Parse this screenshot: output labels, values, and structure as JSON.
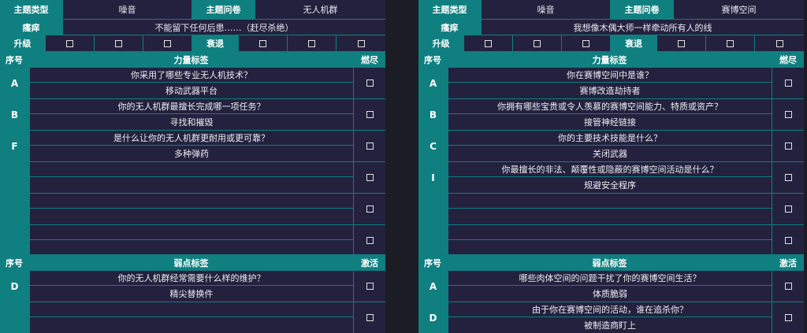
{
  "left": {
    "theme_type_label": "主题类型",
    "theme_type_value": "噪音",
    "theme_q_label": "主题问卷",
    "theme_q_value": "无人机群",
    "itch_label": "瘙痒",
    "itch_value": "不能留下任何后患……（赶尽杀绝）",
    "upgrade_label": "升级",
    "decline_label": "衰退",
    "power_header": {
      "num": "序号",
      "title": "力量标签",
      "check": "燃尽"
    },
    "power_groups": [
      {
        "letter": "A",
        "question": "你采用了哪些专业无人机技术？",
        "answer": "移动武器平台"
      },
      {
        "letter": "B",
        "question": "你的无人机群最擅长完成哪一项任务？",
        "answer": "寻找和摧毁"
      },
      {
        "letter": "F",
        "question": "是什么让你的无人机群更耐用或更可靠？",
        "answer": "多种弹药"
      },
      {
        "letter": "",
        "question": "",
        "answer": ""
      },
      {
        "letter": "",
        "question": "",
        "answer": ""
      },
      {
        "letter": "",
        "question": "",
        "answer": ""
      }
    ],
    "weak_header": {
      "num": "序号",
      "title": "弱点标签",
      "check": "激活"
    },
    "weak_groups": [
      {
        "letter": "D",
        "question": "你的无人机群经常需要什么样的维护？",
        "answer": "精尖替换件"
      },
      {
        "letter": "",
        "question": "",
        "answer": ""
      }
    ]
  },
  "right": {
    "theme_type_label": "主题类型",
    "theme_type_value": "噪音",
    "theme_q_label": "主题问卷",
    "theme_q_value": "赛博空间",
    "itch_label": "瘙痒",
    "itch_value": "我想像木偶大师一样牵动所有人的线",
    "upgrade_label": "升级",
    "decline_label": "衰退",
    "power_header": {
      "num": "序号",
      "title": "力量标签",
      "check": "燃尽"
    },
    "power_groups": [
      {
        "letter": "A",
        "question": "你在赛博空间中是谁？",
        "answer": "赛博改造劫持者"
      },
      {
        "letter": "B",
        "question": "你拥有哪些宝贵或令人羡慕的赛博空间能力、特质或资产？",
        "answer": "接管神经链接"
      },
      {
        "letter": "C",
        "question": "你的主要技术技能是什么？",
        "answer": "关闭武器"
      },
      {
        "letter": "I",
        "question": "你最擅长的非法、颠覆性或隐蔽的赛博空间活动是什么？",
        "answer": "规避安全程序"
      },
      {
        "letter": "",
        "question": "",
        "answer": ""
      },
      {
        "letter": "",
        "question": "",
        "answer": ""
      }
    ],
    "weak_header": {
      "num": "序号",
      "title": "弱点标签",
      "check": "激活"
    },
    "weak_groups": [
      {
        "letter": "A",
        "question": "哪些肉体空间的问题干扰了你的赛博空间生活？",
        "answer": "体质脆弱"
      },
      {
        "letter": "D",
        "question": "由于你在赛博空间的活动，谁在追杀你？",
        "answer": "被制造商盯上"
      }
    ]
  },
  "icons": {
    "checkbox": "checkbox-icon"
  },
  "colors": {
    "teal": "#0f7f80",
    "panel": "#24213e",
    "background": "#1c1c24",
    "border": "#0e7f82"
  }
}
